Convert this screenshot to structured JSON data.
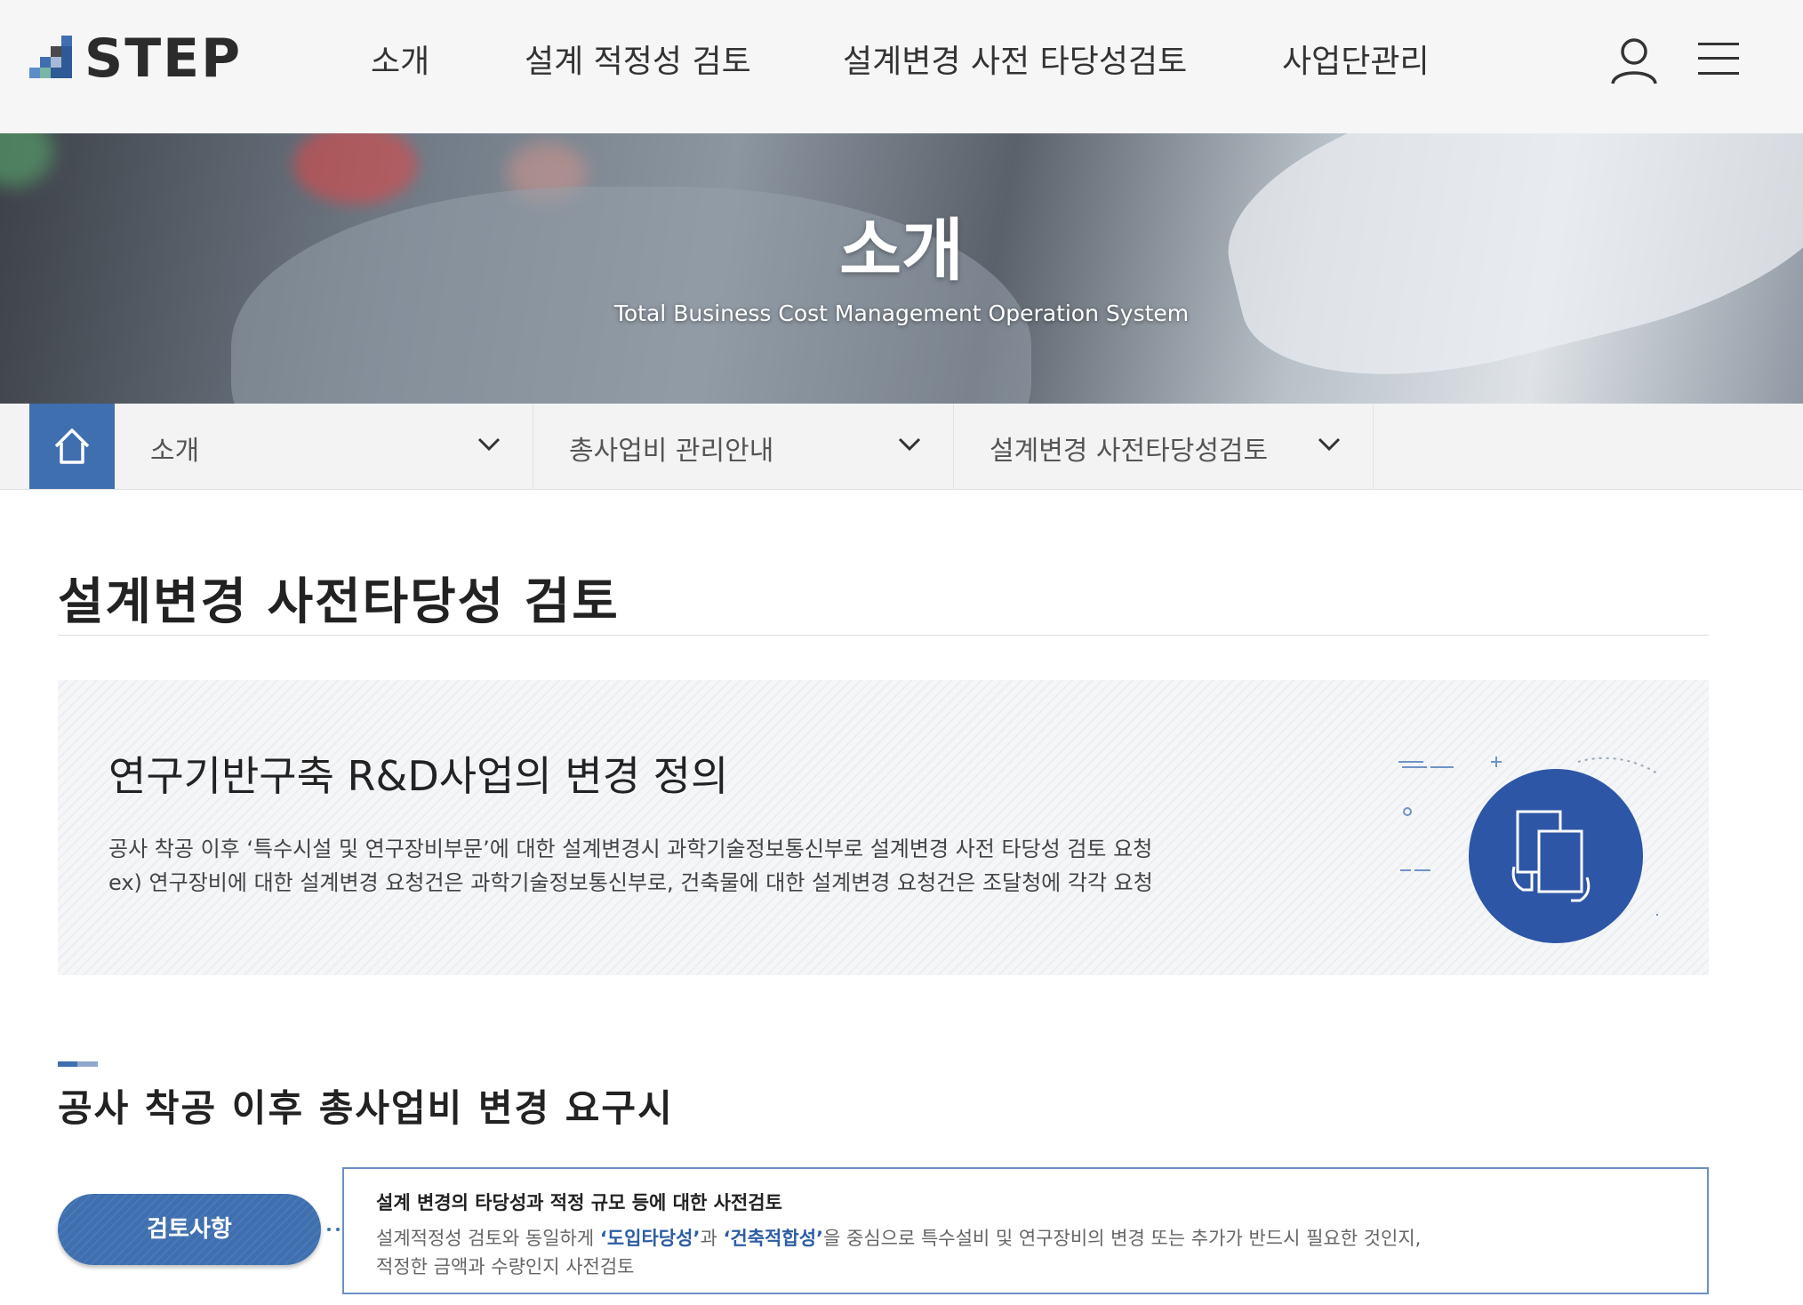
{
  "header": {
    "logo_text": "STEP",
    "nav": [
      "소개",
      "설계 적정성 검토",
      "설계변경 사전 타당성검토",
      "사업단관리"
    ]
  },
  "hero": {
    "title": "소개",
    "subtitle": "Total Business Cost Management Operation System"
  },
  "location": {
    "items": [
      "소개",
      "총사업비 관리안내",
      "설계변경 사전타당성검토"
    ]
  },
  "page_title": "설계변경 사전타당성 검토",
  "definition": {
    "title": "연구기반구축 R&D사업의 변경 정의",
    "line1": "공사 착공 이후 ‘특수시설 및 연구장비부문’에 대한 설계변경시 과학기술정보통신부로 설계변경 사전 타당성 검토 요청",
    "line2": "ex) 연구장비에 대한 설계변경 요청건은 과학기술정보통신부로, 건축물에 대한 설계변경 요청건은 조달청에 각각 요청"
  },
  "section": {
    "title": "공사 착공 이후 총사업비 변경 요구시"
  },
  "review": {
    "label": "검토사항",
    "heading": "설계 변경의 타당성과 적정 규모 등에 대한 사전검토",
    "line1_a": "설계적정성 검토와 동일하게 ",
    "line1_b": "‘도입타당성’",
    "line1_c": "과 ",
    "line1_d": "‘건축적합성’",
    "line1_e": "을 중심으로 특수설비 및 연구장비의 변경 또는 추가가 반드시 필요한 것인지,",
    "line2": "적정한 금액과 수량인지 사전검토"
  },
  "colors": {
    "accent": "#3f6fae",
    "highlight": "#2d5ea3",
    "circle": "#2e56a6"
  }
}
